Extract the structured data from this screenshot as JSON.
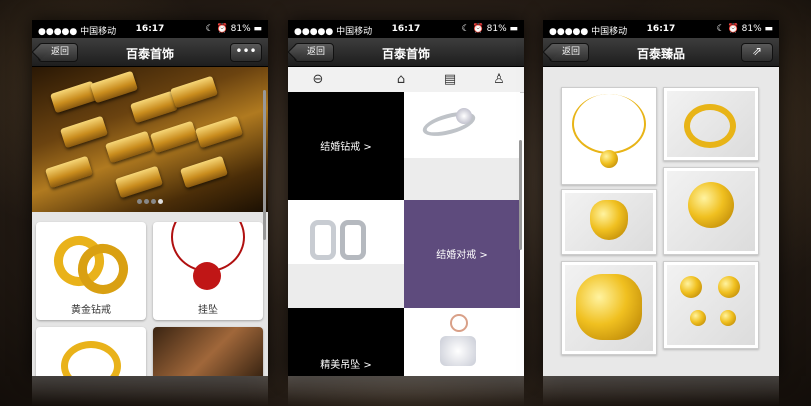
{
  "status": {
    "carrier": "●●●●● 中国移动 ",
    "time": "16:17",
    "battery": "☾ ⏰ 81% ▬"
  },
  "phone1": {
    "back_label": "返回",
    "title": "百泰首饰",
    "more_label": "•••",
    "tiles": [
      {
        "label": "黄金钻戒"
      },
      {
        "label": "挂坠"
      }
    ]
  },
  "phone2": {
    "back_label": "返回",
    "title": "百泰首饰",
    "toolbar": [
      {
        "icon": "back-circle-icon",
        "glyph": "⊖"
      },
      {
        "icon": "home-icon",
        "glyph": "⌂"
      },
      {
        "icon": "news-icon",
        "glyph": "▤"
      },
      {
        "icon": "user-icon",
        "glyph": "♙"
      }
    ],
    "cells": [
      {
        "label": "结婚钻戒 >"
      },
      {
        "label": "结婚对戒 >"
      },
      {
        "label": "精美吊坠 >"
      }
    ]
  },
  "phone3": {
    "back_label": "返回",
    "title": "百泰臻品",
    "share_label": "⇗"
  },
  "colors": {
    "purple": "#5e4b7d",
    "gold": "#e8b417"
  }
}
